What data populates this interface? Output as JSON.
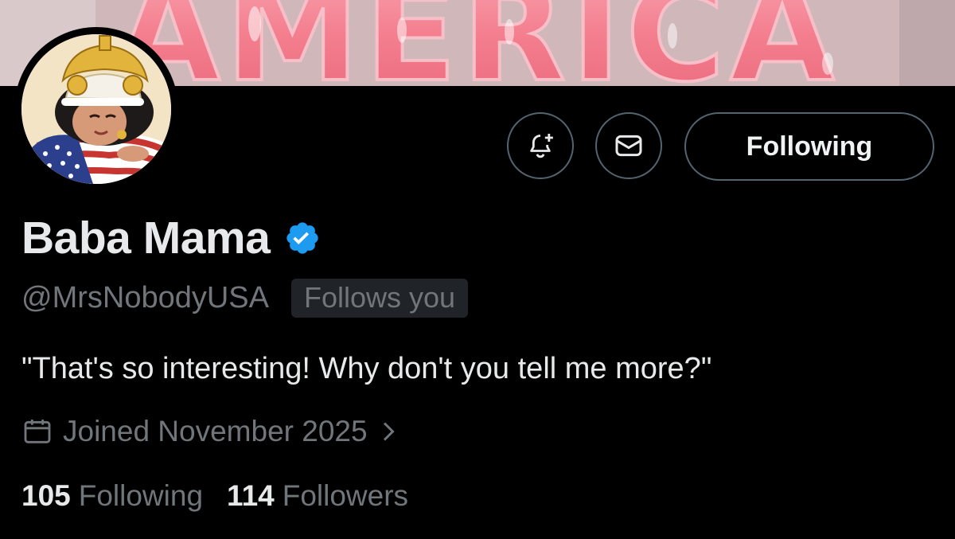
{
  "banner": {
    "text": "AMERICA"
  },
  "profile": {
    "display_name": "Baba Mama",
    "handle": "@MrsNobodyUSA",
    "follows_you_badge": "Follows you",
    "bio": "\"That's so interesting! Why don't you tell me more?\"",
    "joined": "Joined November 2025",
    "following_count": "105",
    "following_label": "Following",
    "followers_count": "114",
    "followers_label": "Followers",
    "verified": true
  },
  "actions": {
    "follow_button_label": "Following",
    "notify_icon": "bell-plus-icon",
    "message_icon": "envelope-icon"
  },
  "colors": {
    "background": "#000000",
    "verified_blue": "#1d9bf0",
    "secondary_text": "#71767b",
    "border": "#536471"
  }
}
